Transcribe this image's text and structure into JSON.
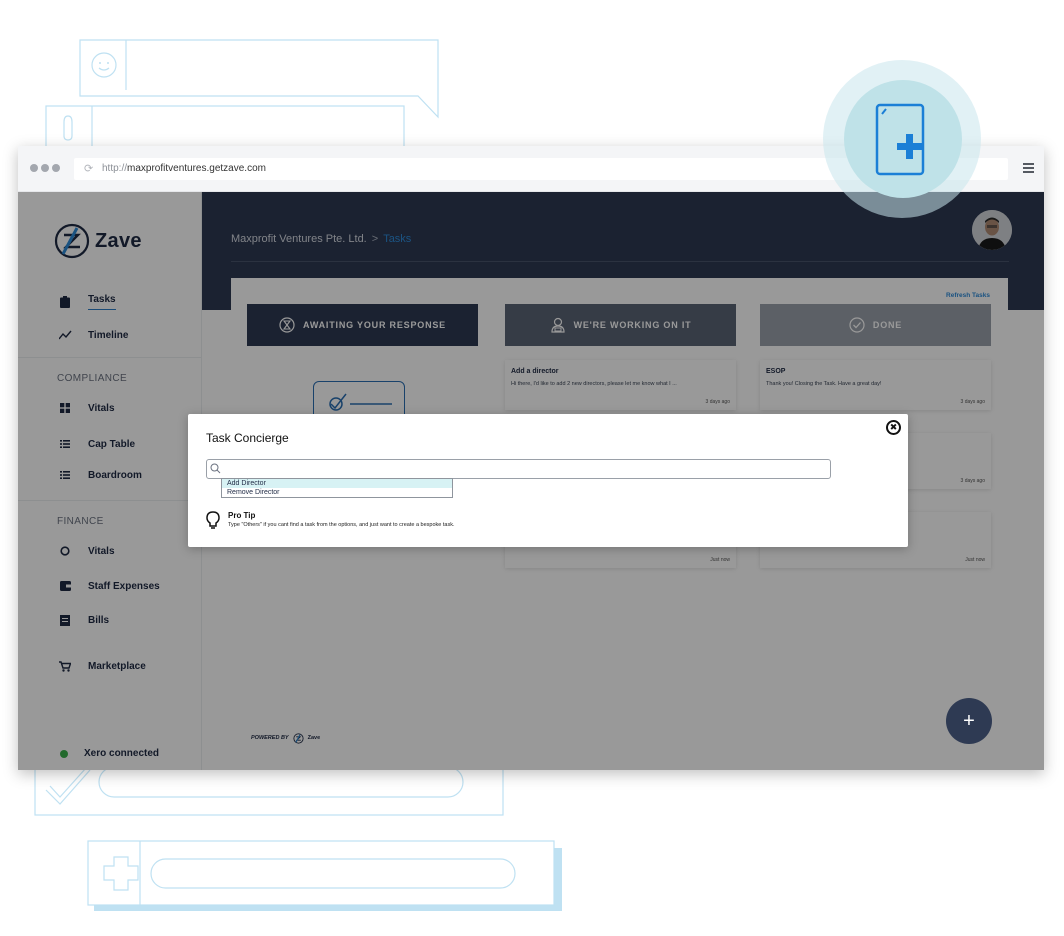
{
  "browser": {
    "url_protocol": "http://",
    "url_host": "maxprofitventures.getzave.com"
  },
  "sidebar": {
    "brand": "Zave",
    "items": [
      {
        "label": "Tasks",
        "icon": "clipboard-icon",
        "active": true
      },
      {
        "label": "Timeline",
        "icon": "trend-line-icon"
      }
    ],
    "compliance": {
      "title": "COMPLIANCE",
      "items": [
        {
          "label": "Vitals",
          "icon": "grid-icon"
        },
        {
          "label": "Cap Table",
          "icon": "list-icon"
        },
        {
          "label": "Boardroom",
          "icon": "list-icon"
        }
      ]
    },
    "finance": {
      "title": "FINANCE",
      "items": [
        {
          "label": "Vitals",
          "icon": "circle-icon"
        },
        {
          "label": "Staff Expenses",
          "icon": "wallet-icon"
        },
        {
          "label": "Bills",
          "icon": "receipt-icon"
        }
      ]
    },
    "marketplace": {
      "label": "Marketplace",
      "icon": "cart-icon"
    },
    "xero_status": "Xero connected",
    "colors": {
      "xero_status": "#3ab04a",
      "active_underline": "#2d7ec6"
    }
  },
  "header": {
    "company": "Maxprofit Ventures Pte. Ltd.",
    "separator": ">",
    "current": "Tasks",
    "colors": {
      "bg": "#2e3a53",
      "current": "#2d8ad8"
    }
  },
  "board": {
    "refresh_label": "Refresh Tasks",
    "columns": [
      {
        "label": "AWAITING YOUR RESPONSE",
        "icon": "hourglass-icon",
        "color": "#2e3a53"
      },
      {
        "label": "WE'RE WORKING ON IT",
        "icon": "agent-icon",
        "color": "#5b6475"
      },
      {
        "label": "DONE",
        "icon": "check-circle-icon",
        "color": "#9aa0aa"
      }
    ],
    "cards": {
      "working": [
        {
          "title": "Add a director",
          "body": "Hi there, I'd like to add 2 new directors, please let me know what I ...",
          "date": "3 days ago"
        },
        {
          "title": "",
          "body": "",
          "date": "Just now"
        }
      ],
      "done": [
        {
          "title": "ESOP",
          "body": "Thank you! Closing the Task. Have a great day!",
          "date": "3 days ago"
        },
        {
          "title": "",
          "body": "",
          "date": "3 days ago"
        },
        {
          "title": "",
          "body": "",
          "date": "Just now"
        }
      ]
    }
  },
  "footer": {
    "powered_by": "POWERED BY",
    "powered_brand": "Zave",
    "fab_label": "+"
  },
  "modal": {
    "title": "Task Concierge",
    "close_label": "✖",
    "search": {
      "value": "",
      "placeholder": ""
    },
    "options": [
      {
        "label": "Add Director",
        "selected": true
      },
      {
        "label": "Remove Director",
        "selected": false
      }
    ],
    "protip_title": "Pro Tip",
    "protip_body": "Type \"Others\" if you cant find a task from the options, and just want to create a bespoke task."
  }
}
